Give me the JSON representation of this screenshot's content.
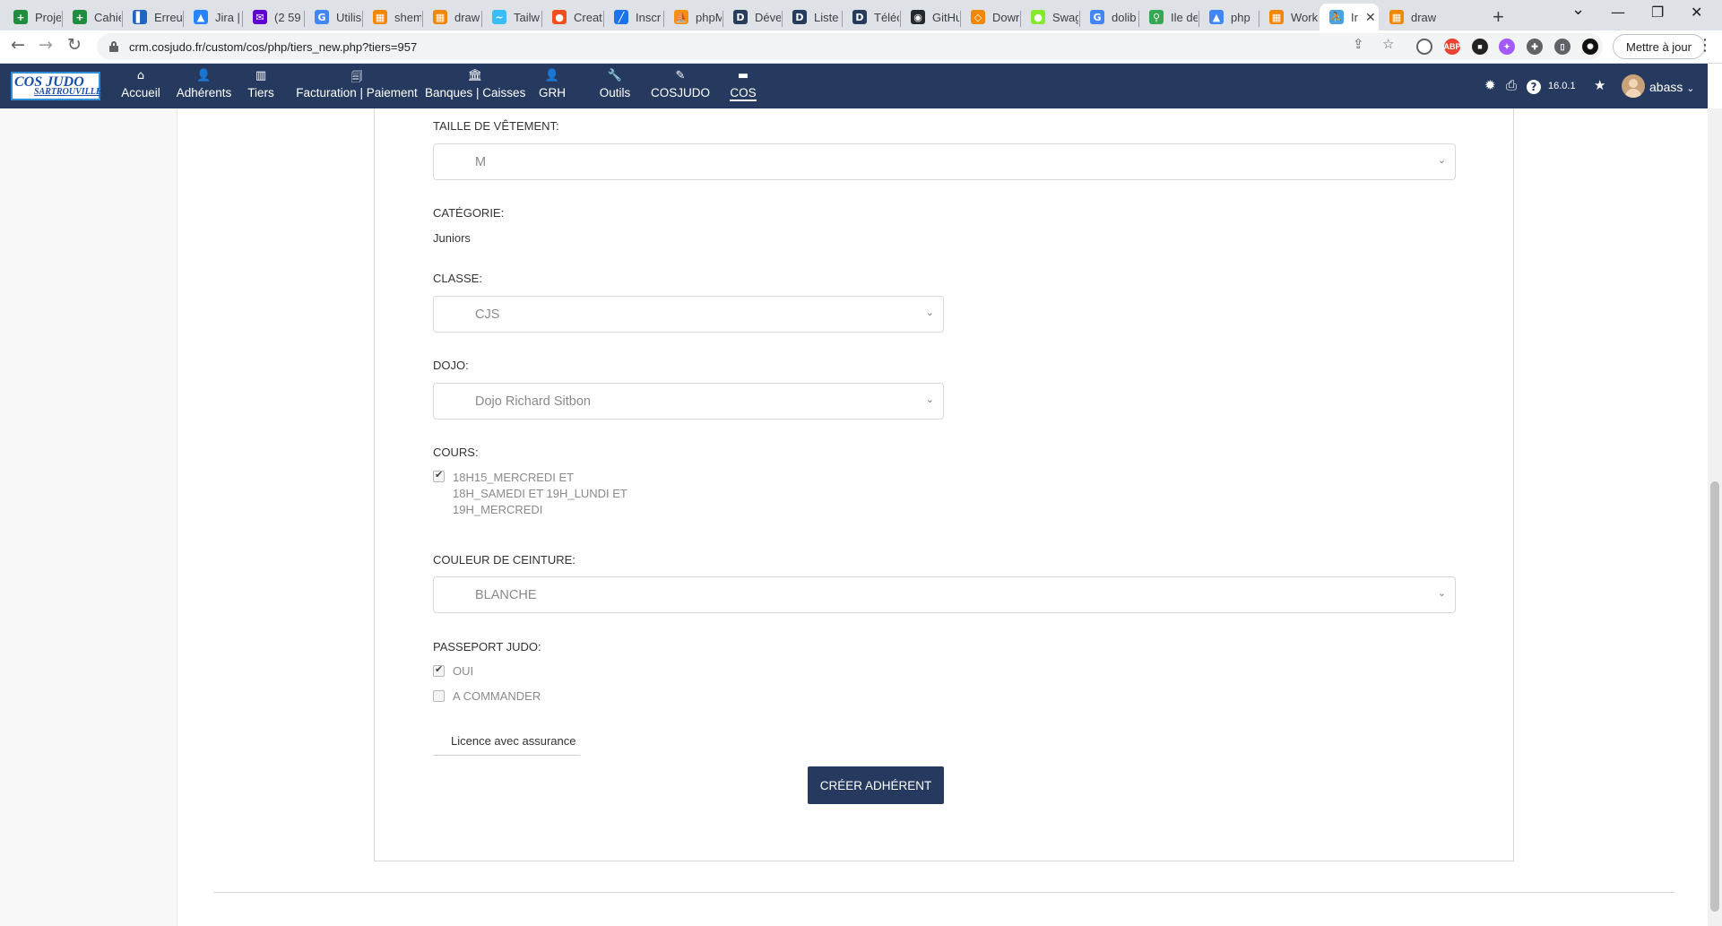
{
  "browser": {
    "tabs": [
      {
        "title": "Proje",
        "fav_color": "#1e8e3e",
        "glyph": "+"
      },
      {
        "title": "Cahie",
        "fav_color": "#1e8e3e",
        "glyph": "+"
      },
      {
        "title": "Erreu",
        "fav_color": "#1e66c1",
        "glyph": "▌"
      },
      {
        "title": "Jira |",
        "fav_color": "#2684ff",
        "glyph": "▲"
      },
      {
        "title": "(2 59",
        "fav_color": "#6001d2",
        "glyph": "✉"
      },
      {
        "title": "Utilis",
        "fav_color": "#4285f4",
        "glyph": "G"
      },
      {
        "title": "shem",
        "fav_color": "#f08705",
        "glyph": "▦"
      },
      {
        "title": "draw",
        "fav_color": "#f08705",
        "glyph": "▦"
      },
      {
        "title": "Tailw",
        "fav_color": "#38bdf8",
        "glyph": "~"
      },
      {
        "title": "Creat",
        "fav_color": "#f24e1e",
        "glyph": "●"
      },
      {
        "title": "Inscr",
        "fav_color": "#1a73e8",
        "glyph": "╱"
      },
      {
        "title": "phpM",
        "fav_color": "#f29111",
        "glyph": "⛵"
      },
      {
        "title": "Déve",
        "fav_color": "#263c5c",
        "glyph": "D"
      },
      {
        "title": "Liste",
        "fav_color": "#263c5c",
        "glyph": "D"
      },
      {
        "title": "Téléc",
        "fav_color": "#263c5c",
        "glyph": "D"
      },
      {
        "title": "GitHu",
        "fav_color": "#24292f",
        "glyph": "◉"
      },
      {
        "title": "Dowr",
        "fav_color": "#f08705",
        "glyph": "◇"
      },
      {
        "title": "Swag",
        "fav_color": "#85ea2d",
        "glyph": "●"
      },
      {
        "title": "dolib",
        "fav_color": "#4285f4",
        "glyph": "G"
      },
      {
        "title": "Ile de",
        "fav_color": "#34a853",
        "glyph": "⚲"
      },
      {
        "title": "php",
        "fav_color": "#4285f4",
        "glyph": "▲"
      },
      {
        "title": "Work",
        "fav_color": "#f08705",
        "glyph": "▦"
      },
      {
        "title": "Ir",
        "fav_color": "#4aa3df",
        "glyph": "⛹"
      },
      {
        "title": "draw",
        "fav_color": "#f08705",
        "glyph": "▦"
      }
    ],
    "close_glyph": "✕",
    "new_tab_glyph": "+",
    "controls": {
      "chevron": "⌄",
      "minimize": "—",
      "restore": "❐",
      "close": "✕"
    },
    "nav": {
      "back": "←",
      "forward": "→",
      "reload": "↻"
    },
    "url": "crm.cosjudo.fr/custom/cos/php/tiers_new.php?tiers=957",
    "omni_icons": {
      "share": "⇪",
      "star": "☆"
    },
    "extensions": [
      {
        "name": "opera-icon",
        "color": "#5f6368",
        "label": ""
      },
      {
        "name": "abp-icon",
        "color": "#e8412f",
        "label": "ABP"
      },
      {
        "name": "extension-black-icon",
        "color": "#222222",
        "label": "■"
      },
      {
        "name": "extension-purple-icon",
        "color": "#a259ff",
        "label": "✦"
      },
      {
        "name": "puzzle-icon",
        "color": "#5f6368",
        "label": "✚"
      },
      {
        "name": "sidepanel-icon",
        "color": "#5f6368",
        "label": "▯"
      },
      {
        "name": "profile-icon",
        "color": "#111111",
        "label": "✺"
      }
    ],
    "update_label": "Mettre à jour",
    "menu_glyph": "⋮"
  },
  "app": {
    "logo": {
      "line1": "COS JUDO",
      "line2": "SARTROUVILLE"
    },
    "menu": [
      {
        "name": "accueil",
        "label": "Accueil",
        "icon": "⌂"
      },
      {
        "name": "adherents",
        "label": "Adhérents",
        "icon": "👤"
      },
      {
        "name": "tiers",
        "label": "Tiers",
        "icon": "▥"
      },
      {
        "name": "facturation",
        "label": "Facturation | Paiement",
        "icon": "🗐"
      },
      {
        "name": "banques",
        "label": "Banques | Caisses",
        "icon": "🏛"
      },
      {
        "name": "grh",
        "label": "GRH",
        "icon": "👤"
      },
      {
        "name": "outils",
        "label": "Outils",
        "icon": "🔧"
      },
      {
        "name": "cosjudo",
        "label": "COSJUDO",
        "icon": "✎"
      },
      {
        "name": "cos",
        "label": "COS",
        "icon": "▬"
      }
    ],
    "right": {
      "bug": "✹",
      "print": "⎙",
      "help": "?",
      "version": "16.0.1",
      "star": "★",
      "user": "abass",
      "caret": "⌄"
    }
  },
  "form": {
    "taille": {
      "label": "TAILLE DE VÊTEMENT:",
      "value": "M"
    },
    "categorie": {
      "label": "CATÉGORIE:",
      "value": "Juniors"
    },
    "classe": {
      "label": "CLASSE:",
      "value": "CJS"
    },
    "dojo": {
      "label": "DOJO:",
      "value": "Dojo Richard Sitbon"
    },
    "cours": {
      "label": "COURS:",
      "option_lines": [
        "18H15_MERCREDI ET",
        "18H_SAMEDI ET 19H_LUNDI ET",
        "19H_MERCREDI"
      ],
      "checked": true
    },
    "ceinture": {
      "label": "COULEUR DE CEINTURE:",
      "value": "BLANCHE"
    },
    "passeport": {
      "label": "PASSEPORT JUDO:",
      "options": [
        {
          "label": "OUI",
          "checked": true
        },
        {
          "label": "A COMMANDER",
          "checked": false
        }
      ]
    },
    "licence_tab": "Licence avec assurance",
    "submit_label": "CRÉER ADHÉRENT",
    "chevron": "⌄",
    "tick": "✔"
  }
}
